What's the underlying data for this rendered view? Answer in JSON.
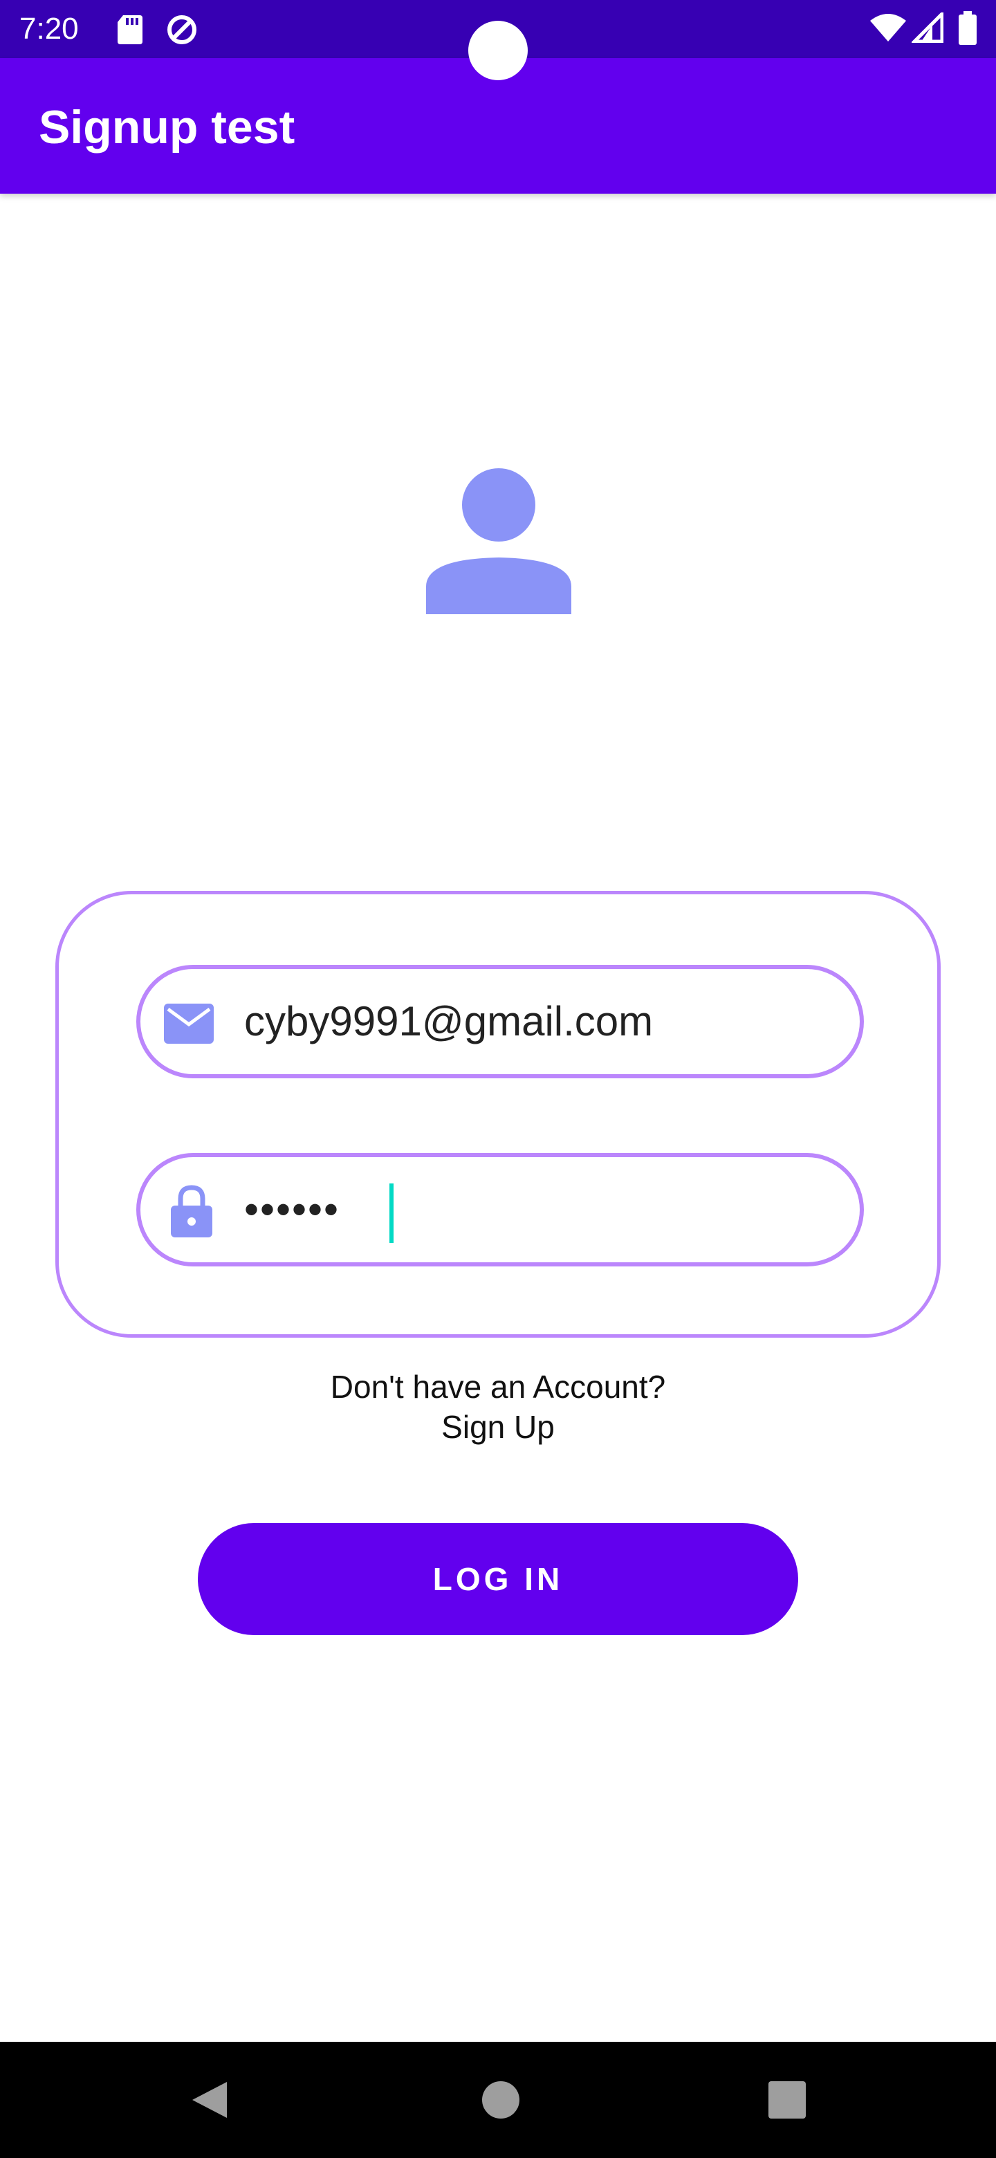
{
  "status_bar": {
    "time": "7:20",
    "icons": [
      "sd-card-icon",
      "sync-icon",
      "wifi-icon",
      "signal-icon",
      "battery-icon"
    ]
  },
  "app_bar": {
    "title": "Signup test"
  },
  "avatar": {
    "icon": "person-icon"
  },
  "login_form": {
    "email": {
      "icon": "email-icon",
      "value": "cyby9991@gmail.com"
    },
    "password": {
      "icon": "lock-icon",
      "value": "••••••"
    }
  },
  "signup": {
    "hint": "Don't have an Account?",
    "link": "Sign Up"
  },
  "login_button": {
    "label": "LOG IN"
  },
  "nav_bar": {
    "buttons": [
      "back-icon",
      "home-icon",
      "recents-icon"
    ]
  },
  "colors": {
    "status_bar": "#3700b3",
    "app_bar": "#6200ee",
    "outline": "#bb86fc",
    "icon_tint": "#8a93f7",
    "cursor": "#03dac5",
    "button": "#6200ee"
  }
}
